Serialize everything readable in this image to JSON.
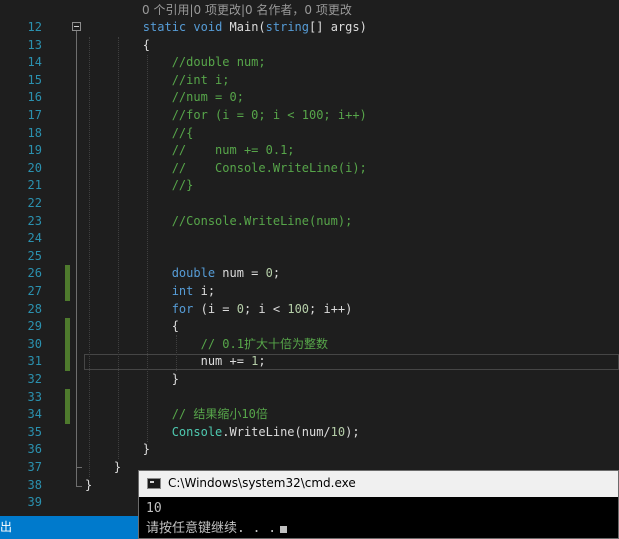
{
  "editor": {
    "codelens": "0 个引用|0 项更改|0 名作者，0 项更改",
    "lines": [
      {
        "n": "12",
        "tokens": [
          {
            "t": "        "
          },
          {
            "t": "static",
            "c": "kw"
          },
          {
            "t": " "
          },
          {
            "t": "void",
            "c": "kw"
          },
          {
            "t": " Main("
          },
          {
            "t": "string",
            "c": "kw"
          },
          {
            "t": "[] args)"
          }
        ]
      },
      {
        "n": "13",
        "tokens": [
          {
            "t": "        {"
          }
        ]
      },
      {
        "n": "14",
        "tokens": [
          {
            "t": "            "
          },
          {
            "t": "//double num;",
            "c": "cm"
          }
        ]
      },
      {
        "n": "15",
        "tokens": [
          {
            "t": "            "
          },
          {
            "t": "//int i;",
            "c": "cm"
          }
        ]
      },
      {
        "n": "16",
        "tokens": [
          {
            "t": "            "
          },
          {
            "t": "//num = 0;",
            "c": "cm"
          }
        ]
      },
      {
        "n": "17",
        "tokens": [
          {
            "t": "            "
          },
          {
            "t": "//for (i = 0; i < 100; i++)",
            "c": "cm"
          }
        ]
      },
      {
        "n": "18",
        "tokens": [
          {
            "t": "            "
          },
          {
            "t": "//{",
            "c": "cm"
          }
        ]
      },
      {
        "n": "19",
        "tokens": [
          {
            "t": "            "
          },
          {
            "t": "//    num += 0.1;",
            "c": "cm"
          }
        ]
      },
      {
        "n": "20",
        "tokens": [
          {
            "t": "            "
          },
          {
            "t": "//    Console.WriteLine(i);",
            "c": "cm"
          }
        ]
      },
      {
        "n": "21",
        "tokens": [
          {
            "t": "            "
          },
          {
            "t": "//}",
            "c": "cm"
          }
        ]
      },
      {
        "n": "22",
        "tokens": []
      },
      {
        "n": "23",
        "tokens": [
          {
            "t": "            "
          },
          {
            "t": "//Console.WriteLine(num);",
            "c": "cm"
          }
        ]
      },
      {
        "n": "24",
        "tokens": []
      },
      {
        "n": "25",
        "tokens": []
      },
      {
        "n": "26",
        "tokens": [
          {
            "t": "            "
          },
          {
            "t": "double",
            "c": "kw"
          },
          {
            "t": " num = "
          },
          {
            "t": "0",
            "c": "num"
          },
          {
            "t": ";"
          }
        ]
      },
      {
        "n": "27",
        "tokens": [
          {
            "t": "            "
          },
          {
            "t": "int",
            "c": "kw"
          },
          {
            "t": " i;"
          }
        ]
      },
      {
        "n": "28",
        "tokens": [
          {
            "t": "            "
          },
          {
            "t": "for",
            "c": "kw"
          },
          {
            "t": " (i = "
          },
          {
            "t": "0",
            "c": "num"
          },
          {
            "t": "; i < "
          },
          {
            "t": "100",
            "c": "num"
          },
          {
            "t": "; i++)"
          }
        ]
      },
      {
        "n": "29",
        "tokens": [
          {
            "t": "            {"
          }
        ]
      },
      {
        "n": "30",
        "tokens": [
          {
            "t": "                "
          },
          {
            "t": "// 0.1扩大十倍为整数",
            "c": "cm"
          }
        ]
      },
      {
        "n": "31",
        "tokens": [
          {
            "t": "                num += "
          },
          {
            "t": "1",
            "c": "num"
          },
          {
            "t": ";"
          }
        ]
      },
      {
        "n": "32",
        "tokens": [
          {
            "t": "            }"
          }
        ]
      },
      {
        "n": "33",
        "tokens": []
      },
      {
        "n": "34",
        "tokens": [
          {
            "t": "            "
          },
          {
            "t": "// 结果缩小10倍",
            "c": "cm"
          }
        ]
      },
      {
        "n": "35",
        "tokens": [
          {
            "t": "            "
          },
          {
            "t": "Console",
            "c": "ty"
          },
          {
            "t": ".WriteLine(num/"
          },
          {
            "t": "10",
            "c": "num"
          },
          {
            "t": ");"
          }
        ]
      },
      {
        "n": "36",
        "tokens": [
          {
            "t": "        }"
          }
        ]
      },
      {
        "n": "37",
        "tokens": [
          {
            "t": "    }"
          }
        ]
      },
      {
        "n": "38",
        "tokens": [
          {
            "t": "}"
          }
        ]
      },
      {
        "n": "39",
        "tokens": []
      }
    ]
  },
  "status": {
    "label": "输出"
  },
  "console": {
    "title": "C:\\Windows\\system32\\cmd.exe",
    "output": [
      "10",
      "请按任意键继续. . ."
    ]
  }
}
